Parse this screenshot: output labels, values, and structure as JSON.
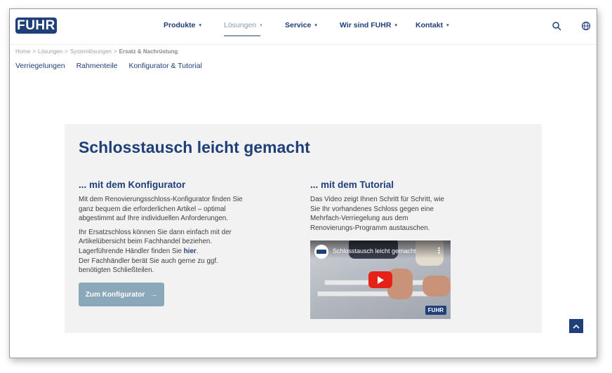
{
  "logo": {
    "text": "FUHR"
  },
  "nav": {
    "items": [
      {
        "label": "Produkte",
        "active": false
      },
      {
        "label": "Lösungen",
        "active": true
      },
      {
        "label": "Service",
        "active": false
      },
      {
        "label": "Wir sind FUHR",
        "active": false
      },
      {
        "label": "Kontakt",
        "active": false
      }
    ]
  },
  "header_icons": [
    "search-icon",
    "globe-icon"
  ],
  "breadcrumb": {
    "items": [
      "Home",
      "Lösungen",
      "Systemlösungen",
      "Ersatz & Nachrüstung"
    ],
    "separator": ">"
  },
  "subnav": {
    "items": [
      "Verriegelungen",
      "Rahmenteile",
      "Konfigurator & Tutorial"
    ]
  },
  "panel": {
    "title": "Schlosstausch leicht gemacht",
    "left": {
      "heading": "... mit dem Konfigurator",
      "para1": "Mit dem Renovierungsschloss-Konfigurator finden Sie ganz bequem die erforderlichen Artikel – optimal abgestimmt auf Ihre individuellen Anforderungen.",
      "para2_part1": "Ihr Ersatzschloss können Sie dann einfach mit der Artikelübersicht beim Fachhandel beziehen. Lagerführende Händler finden Sie ",
      "para2_link": "hier",
      "para2_part2": ".",
      "para3": "Der Fachhändler berät Sie auch gerne zu ggf. benötigten Schließteilen.",
      "button_label": "Zum Konfigurator",
      "button_arrow": "→"
    },
    "right": {
      "heading": "... mit dem Tutorial",
      "para": "Das Video zeigt Ihnen Schritt für Schritt, wie Sie Ihr vorhandenes Schloss gegen eine Mehrfach-Verriegelung aus dem Renovierungs-Programm austauschen.",
      "video": {
        "title": "Schlosstausch leicht gemacht",
        "brand": "FUHR",
        "menu": "⋮"
      }
    }
  },
  "colors": {
    "brand": "#1f3f78",
    "nav_active": "#8a9bb8",
    "panel_bg": "#f2f2f2",
    "button": "#8aa8ba",
    "play": "#e62117"
  }
}
